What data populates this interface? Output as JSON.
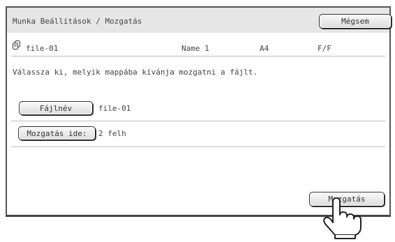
{
  "header": {
    "title": "Munka Beállítások / Mozgatás",
    "cancel_label": "Mégsem"
  },
  "file": {
    "icon": "file-stack-icon",
    "name": "file-01",
    "user": "Name 1",
    "paper_size": "A4",
    "color_mode": "F/F"
  },
  "instruction": "Válassza ki, melyik mappába kívánja mozgatni a fájlt.",
  "fields": {
    "filename_label": "Fájlnév",
    "filename_value": "file-01",
    "destination_label": "Mozgatás ide:",
    "destination_value": "2 felh"
  },
  "actions": {
    "move_label": "Mozgatás"
  },
  "pointer": {
    "icon": "hand-pointer-icon"
  }
}
